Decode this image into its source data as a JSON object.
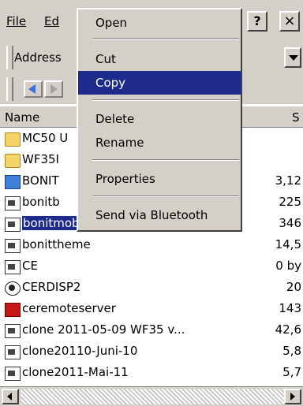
{
  "menubar": {
    "file": "File",
    "edit": "Ed",
    "help_btn": "?",
    "close_btn": "×"
  },
  "address": {
    "label": "Address"
  },
  "columns": {
    "name": "Name",
    "size": "S"
  },
  "files": [
    {
      "name": "MC50 U",
      "size": "",
      "icon": "folder-icon"
    },
    {
      "name": "WF35I",
      "size": "",
      "icon": "folder-icon"
    },
    {
      "name": "BONIT",
      "size": "3,12",
      "icon": "app-icon"
    },
    {
      "name": "bonitb",
      "size": "225",
      "icon": "document-icon"
    },
    {
      "name": "bonitmobile",
      "size": "346",
      "icon": "document-icon",
      "selected": true
    },
    {
      "name": "bonittheme",
      "size": "14,5",
      "icon": "document-icon"
    },
    {
      "name": "CE",
      "size": "0 by",
      "icon": "document-icon"
    },
    {
      "name": "CERDISP2",
      "size": "20",
      "icon": "cd-icon"
    },
    {
      "name": "ceremoteserver",
      "size": "143",
      "icon": "red-app-icon"
    },
    {
      "name": "clone 2011-05-09 WF35 v...",
      "size": "42,6",
      "icon": "document-icon"
    },
    {
      "name": "clone20110-Juni-10",
      "size": "5,8",
      "icon": "document-icon"
    },
    {
      "name": "clone2011-Mai-11",
      "size": "5,7",
      "icon": "document-icon"
    }
  ],
  "context_menu": {
    "open": "Open",
    "cut": "Cut",
    "copy": "Copy",
    "delete": "Delete",
    "rename": "Rename",
    "properties": "Properties",
    "send_bluetooth": "Send via Bluetooth"
  },
  "colors": {
    "highlight": "#1e2a8c",
    "chrome": "#d4d0c8"
  }
}
